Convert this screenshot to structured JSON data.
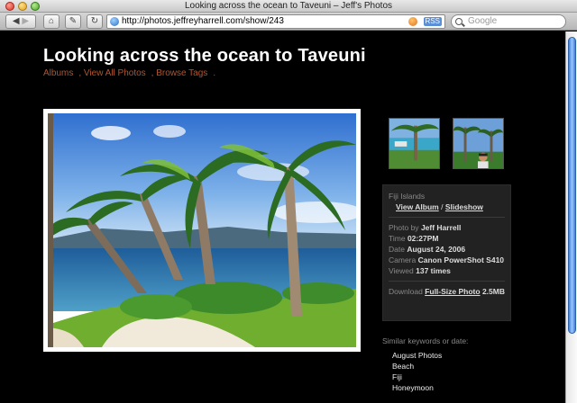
{
  "window": {
    "title": "Looking across the ocean to Taveuni – Jeff's Photos"
  },
  "toolbar": {
    "back_icon": "back-arrow-icon",
    "forward_icon": "forward-arrow-icon",
    "url": "http://photos.jeffreyharrell.com/show/243",
    "rss_label": "RSS",
    "search_placeholder": "Google"
  },
  "page": {
    "title": "Looking across the ocean to Taveuni",
    "nav": [
      "Albums",
      "View All Photos",
      "Browse Tags"
    ]
  },
  "info": {
    "album_name": "Fiji Islands",
    "view_album": "View Album",
    "separator": "/",
    "slideshow": "Slideshow",
    "photo_by_label": "Photo by",
    "photo_by": "Jeff Harrell",
    "time_label": "Time",
    "time": "02:27PM",
    "date_label": "Date",
    "date": "August 24, 2006",
    "camera_label": "Camera",
    "camera": "Canon PowerShot S410",
    "viewed_label": "Viewed",
    "viewed": "137 times",
    "download_label": "Download",
    "download_link": "Full-Size Photo",
    "download_size": "2.5MB"
  },
  "similar": {
    "heading": "Similar keywords or date:",
    "items": [
      "August Photos",
      "Beach",
      "Fiji",
      "Honeymoon"
    ]
  },
  "colors": {
    "background": "#000000",
    "nav_link": "#b2552d",
    "info_box": "#222222"
  }
}
